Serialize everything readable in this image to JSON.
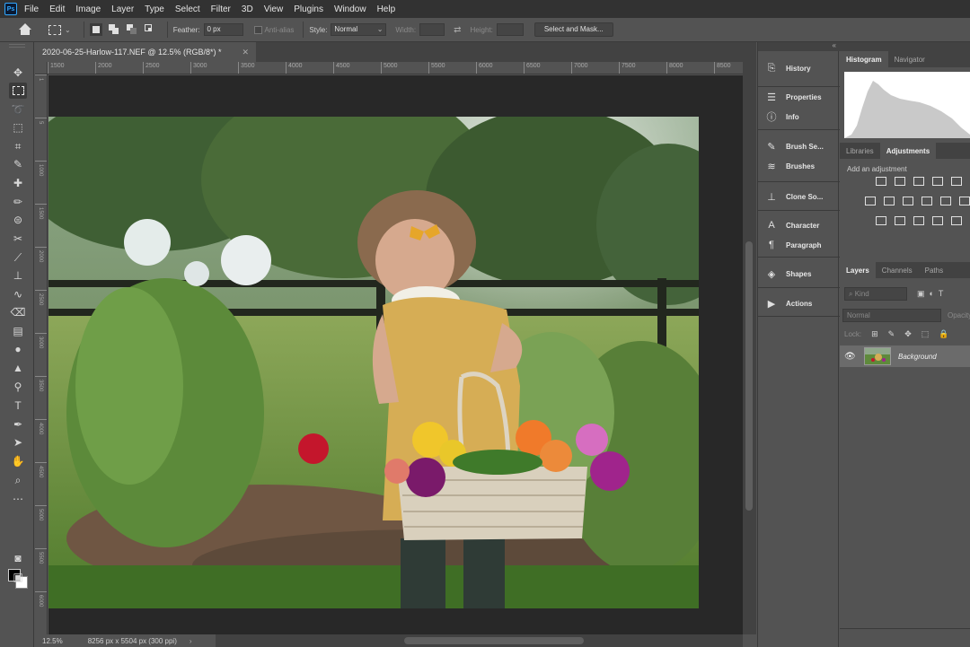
{
  "app": {
    "logo": "Ps"
  },
  "menu": [
    "File",
    "Edit",
    "Image",
    "Layer",
    "Type",
    "Select",
    "Filter",
    "3D",
    "View",
    "Plugins",
    "Window",
    "Help"
  ],
  "options": {
    "feather_label": "Feather:",
    "feather_value": "0 px",
    "antialias_label": "Anti-alias",
    "style_label": "Style:",
    "style_value": "Normal",
    "width_label": "Width:",
    "height_label": "Height:",
    "select_mask_label": "Select and Mask..."
  },
  "document": {
    "tab_title": "2020-06-25-Harlow-117.NEF @ 12.5% (RGB/8*) *",
    "zoom": "12.5%",
    "info": "8256 px x 5504 px (300 ppi)",
    "ruler_h": [
      "1500",
      "2000",
      "2500",
      "3000",
      "3500",
      "4000",
      "4500",
      "5000",
      "5500",
      "6000",
      "6500",
      "7000",
      "7500",
      "8000",
      "8500"
    ],
    "ruler_v": [
      "1",
      "5",
      "1000",
      "1500",
      "2000",
      "2500",
      "3000",
      "3500",
      "4000",
      "4500",
      "5000",
      "5500",
      "6000"
    ]
  },
  "collapsed_panels": {
    "history": "History",
    "properties": "Properties",
    "info": "Info",
    "brush_settings": "Brush Se...",
    "brushes": "Brushes",
    "clone_source": "Clone So...",
    "character": "Character",
    "paragraph": "Paragraph",
    "shapes": "Shapes",
    "actions": "Actions"
  },
  "right_panels": {
    "tabs1": [
      "Histogram",
      "Navigator"
    ],
    "tabs2": [
      "Libraries",
      "Adjustments"
    ],
    "adj_hint": "Add an adjustment",
    "tabs3": [
      "Layers",
      "Channels",
      "Paths"
    ],
    "layers_search": "Kind",
    "blend_mode": "Normal",
    "opacity_label": "Opacity",
    "lock_label": "Lock:",
    "layer_name": "Background"
  }
}
